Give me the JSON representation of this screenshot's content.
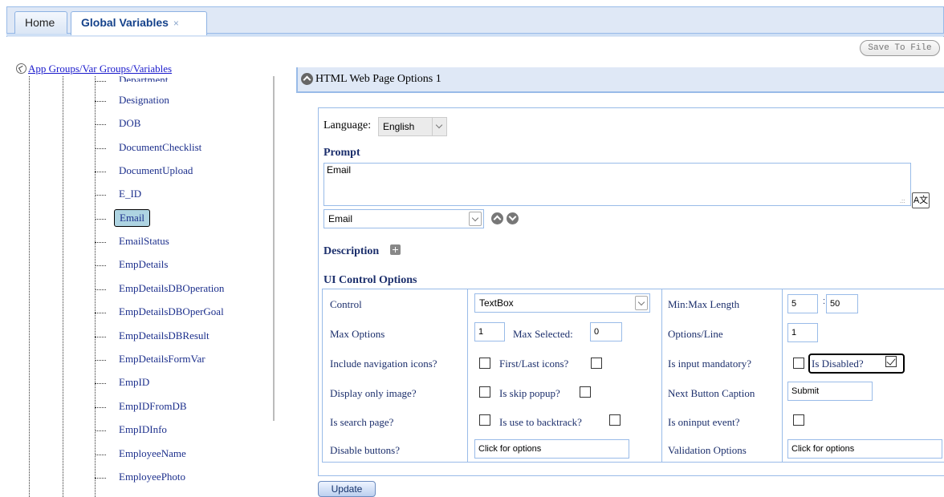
{
  "tabs": {
    "home": "Home",
    "active": "Global Variables",
    "close": "×"
  },
  "toolbar": {
    "save_label": "Save To File"
  },
  "tree": {
    "title": "App Groups/Var Groups/Variables",
    "items": [
      "Department",
      "Designation",
      "DOB",
      "DocumentChecklist",
      "DocumentUpload",
      "E_ID",
      "Email",
      "EmailStatus",
      "EmpDetails",
      "EmpDetailsDBOperation",
      "EmpDetailsDBOperGoal",
      "EmpDetailsDBResult",
      "EmpDetailsFormVar",
      "EmpID",
      "EmpIDFromDB",
      "EmpIDInfo",
      "EmployeeName",
      "EmployeePhoto"
    ],
    "selected": "Email"
  },
  "panel": {
    "title": "HTML Web Page Options 1",
    "language_label": "Language:",
    "language_value": "English",
    "prompt_heading": "Prompt",
    "prompt_text": "Email",
    "prompt_select": "Email",
    "description_heading": "Description",
    "ui_heading": "UI Control Options"
  },
  "options": {
    "control_label": "Control",
    "control_value": "TextBox",
    "max_options_label": "Max Options",
    "max_options_value": "1",
    "max_selected_label": "Max Selected:",
    "max_selected_value": "0",
    "include_nav_label": "Include navigation icons?",
    "first_last_label": "First/Last icons?",
    "display_image_label": "Display only image?",
    "skip_popup_label": "Is skip popup?",
    "search_page_label": "Is search page?",
    "backtrack_label": "Is use to backtrack?",
    "disable_buttons_label": "Disable buttons?",
    "disable_buttons_value": "Click for options",
    "minmax_label": "Min:Max Length",
    "min_value": "5",
    "max_value": "50",
    "options_line_label": "Options/Line",
    "options_line_value": "1",
    "mandatory_label": "Is input mandatory?",
    "disabled_label": "Is Disabled?",
    "next_caption_label": "Next Button Caption",
    "next_caption_value": "Submit",
    "oninput_label": "Is oninput event?",
    "validation_label": "Validation Options",
    "validation_value": "Click for options"
  },
  "footer": {
    "update_label": "Update"
  }
}
